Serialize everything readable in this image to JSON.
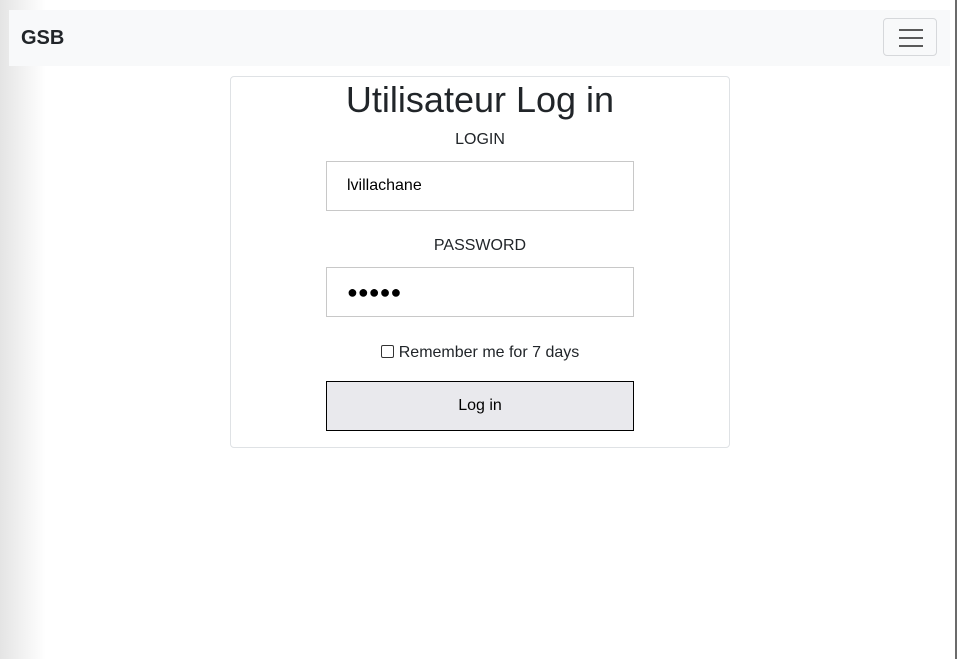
{
  "navbar": {
    "brand": "GSB",
    "toggler_icon": "hamburger-icon"
  },
  "login_card": {
    "title": "Utilisateur Log in",
    "login_label": "LOGIN",
    "login_value": "lvillachane",
    "password_label": "PASSWORD",
    "password_masked": "●●●●●",
    "remember_label": "Remember me for 7 days",
    "remember_checked": false,
    "submit_label": "Log in"
  }
}
